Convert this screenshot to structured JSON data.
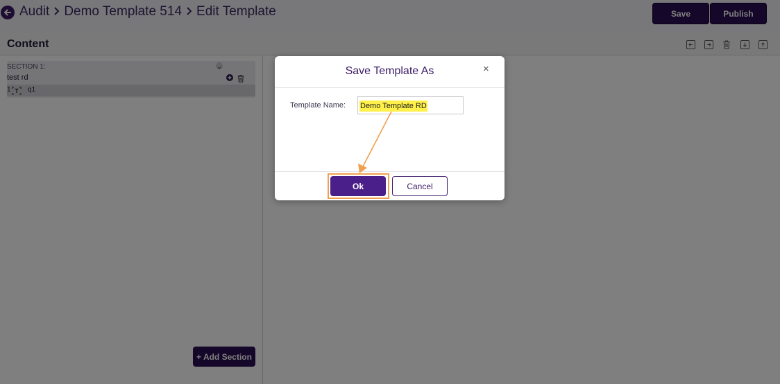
{
  "header": {
    "breadcrumb": [
      "Audit",
      "Demo Template 514",
      "Edit Template"
    ],
    "save_label": "Save",
    "publish_label": "Publish"
  },
  "content": {
    "title": "Content",
    "toolbar_icons": [
      "indent-left-icon",
      "indent-right-icon",
      "trash-icon",
      "move-down-icon",
      "move-up-icon"
    ]
  },
  "section": {
    "label": "SECTION 1:",
    "name": "test rd",
    "question": {
      "number": "1",
      "type_icon": "text-question-icon",
      "text": "q1"
    }
  },
  "add_section_label": "+ Add Section",
  "modal": {
    "title": "Save Template As",
    "close_label": "×",
    "field_label": "Template Name:",
    "field_value": "Demo Template RD",
    "ok_label": "Ok",
    "cancel_label": "Cancel"
  },
  "colors": {
    "brand": "#2a0f52",
    "primary_button": "#4a1f8a",
    "highlight": "#fff04a",
    "annotation": "#f0a050"
  }
}
